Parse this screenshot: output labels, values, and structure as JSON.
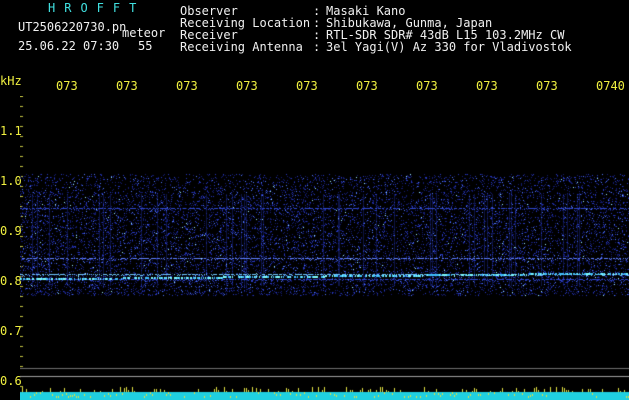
{
  "header": {
    "title": "HROFFT",
    "filename": "UT2506220730.pn",
    "type_label": "meteor",
    "datetime": "25.06.22 07:30",
    "count": "55"
  },
  "metadata": [
    {
      "label": "Observer",
      "value": "Masaki Kano"
    },
    {
      "label": "Receiving Location",
      "value": "Shibukawa, Gunma, Japan"
    },
    {
      "label": "Receiver",
      "value": "RTL-SDR SDR# 43dB L15 103.2MHz CW"
    },
    {
      "label": "Receiving Antenna",
      "value": "3el Yagi(V) Az 330 for Vladivostok"
    }
  ],
  "axis": {
    "y_unit": "kHz",
    "y_ticks": [
      "1.1",
      "1.0",
      "0.9",
      "0.8",
      "0.7",
      "0.6"
    ],
    "time_ticks": [
      "073",
      "073",
      "073",
      "073",
      "073",
      "073",
      "073",
      "073",
      "073",
      "0740"
    ]
  },
  "colors": {
    "background": "#000000",
    "text_meta": "#f0f0f0",
    "text_title": "#40e0e0",
    "tick_labels": "#f0f040",
    "signal": "#4060ff",
    "signal_bright": "#60e0ff"
  }
}
